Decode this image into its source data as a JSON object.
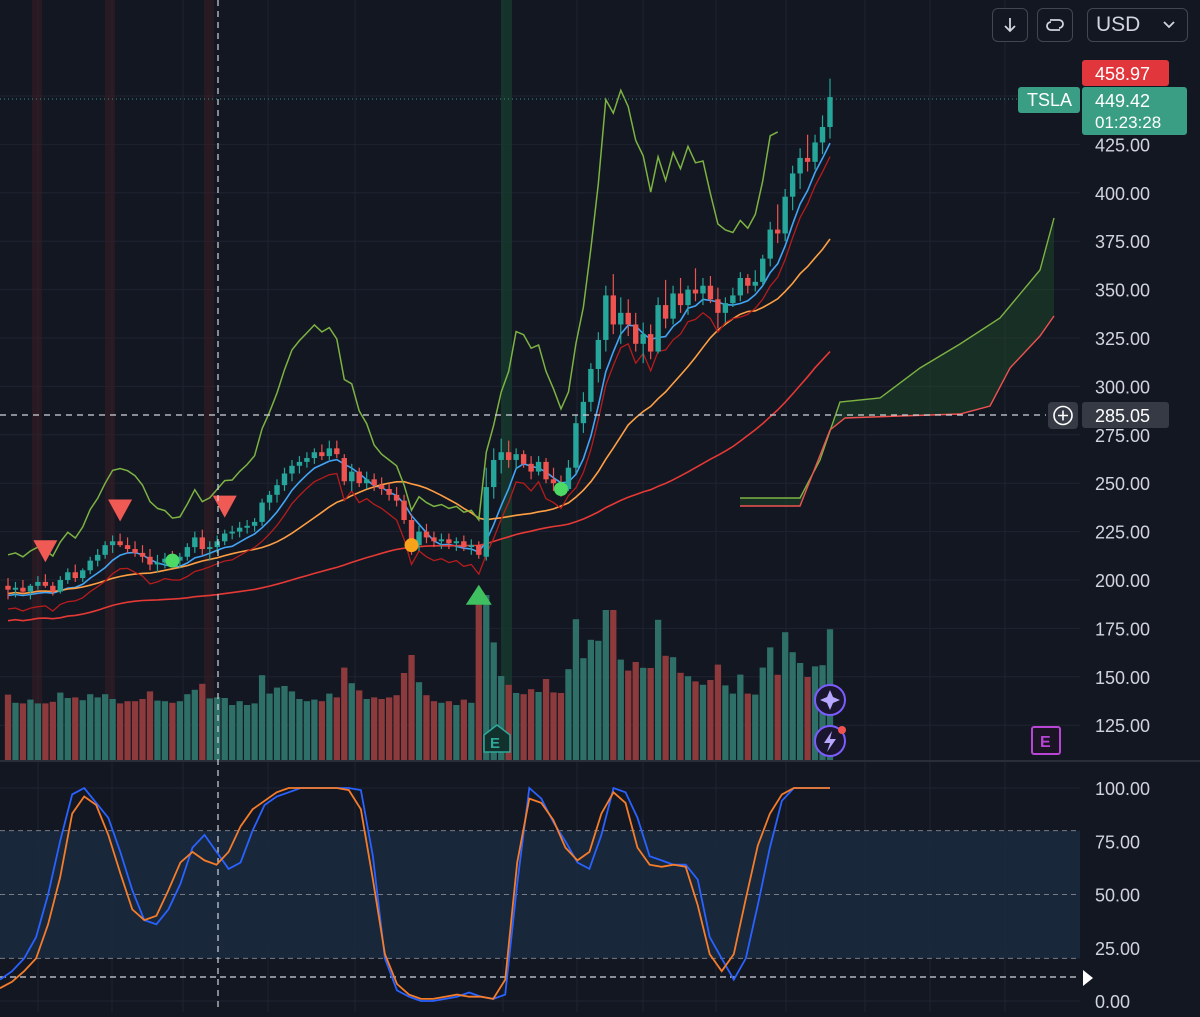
{
  "toolbar": {
    "currency_label": "USD",
    "icons": [
      "arrow-down-icon",
      "loop-icon",
      "chevron-down-icon"
    ]
  },
  "symbol": "TSLA",
  "price_tags": {
    "high": "458.97",
    "last": "449.42",
    "countdown": "01:23:28",
    "crosshair": "285.05"
  },
  "colors": {
    "background": "#131722",
    "up": "#26a69a",
    "down": "#ef5350",
    "volume_up": "#2e6f68",
    "volume_down": "#8c3a3c",
    "k_line": "#2962ff",
    "d_line": "#f57c2a",
    "upper_band": "#7cb342",
    "ma_blue": "#42a5f5",
    "ma_orange": "#ff9f43",
    "ma_red": "#e53935",
    "event_purple": "#b845d6"
  },
  "event_markers": {
    "earnings_letter": "E",
    "icons": [
      "sparkle-icon",
      "lightning-icon"
    ]
  },
  "chart_data": [
    {
      "type": "candlestick",
      "symbol": "TSLA",
      "currency": "USD",
      "y_ticks": [
        "125.00",
        "150.00",
        "175.00",
        "200.00",
        "225.00",
        "250.00",
        "275.00",
        "300.00",
        "325.00",
        "350.00",
        "375.00",
        "400.00",
        "425.00"
      ],
      "ylim": [
        112,
        475
      ],
      "scale": "linear",
      "grid": true,
      "candles": [
        {
          "o": 197,
          "h": 201,
          "l": 190,
          "c": 195
        },
        {
          "o": 195,
          "h": 199,
          "l": 191,
          "c": 196
        },
        {
          "o": 196,
          "h": 200,
          "l": 193,
          "c": 194
        },
        {
          "o": 194,
          "h": 198,
          "l": 190,
          "c": 197
        },
        {
          "o": 197,
          "h": 202,
          "l": 195,
          "c": 199
        },
        {
          "o": 199,
          "h": 203,
          "l": 196,
          "c": 197
        },
        {
          "o": 197,
          "h": 199,
          "l": 192,
          "c": 194
        },
        {
          "o": 194,
          "h": 202,
          "l": 193,
          "c": 200
        },
        {
          "o": 200,
          "h": 206,
          "l": 198,
          "c": 204
        },
        {
          "o": 204,
          "h": 208,
          "l": 199,
          "c": 201
        },
        {
          "o": 201,
          "h": 206,
          "l": 199,
          "c": 205
        },
        {
          "o": 205,
          "h": 212,
          "l": 203,
          "c": 210
        },
        {
          "o": 210,
          "h": 216,
          "l": 207,
          "c": 213
        },
        {
          "o": 213,
          "h": 220,
          "l": 211,
          "c": 218
        },
        {
          "o": 218,
          "h": 223,
          "l": 214,
          "c": 220
        },
        {
          "o": 220,
          "h": 224,
          "l": 217,
          "c": 218
        },
        {
          "o": 218,
          "h": 222,
          "l": 214,
          "c": 216
        },
        {
          "o": 216,
          "h": 220,
          "l": 212,
          "c": 214
        },
        {
          "o": 214,
          "h": 218,
          "l": 209,
          "c": 212
        },
        {
          "o": 212,
          "h": 216,
          "l": 205,
          "c": 208
        },
        {
          "o": 208,
          "h": 213,
          "l": 204,
          "c": 209
        },
        {
          "o": 209,
          "h": 214,
          "l": 206,
          "c": 211
        },
        {
          "o": 211,
          "h": 215,
          "l": 207,
          "c": 210
        },
        {
          "o": 210,
          "h": 214,
          "l": 206,
          "c": 212
        },
        {
          "o": 212,
          "h": 219,
          "l": 210,
          "c": 217
        },
        {
          "o": 217,
          "h": 225,
          "l": 214,
          "c": 222
        },
        {
          "o": 222,
          "h": 226,
          "l": 213,
          "c": 216
        },
        {
          "o": 216,
          "h": 220,
          "l": 210,
          "c": 217
        },
        {
          "o": 217,
          "h": 223,
          "l": 214,
          "c": 220
        },
        {
          "o": 220,
          "h": 226,
          "l": 218,
          "c": 224
        },
        {
          "o": 224,
          "h": 228,
          "l": 221,
          "c": 225
        },
        {
          "o": 225,
          "h": 230,
          "l": 222,
          "c": 227
        },
        {
          "o": 227,
          "h": 231,
          "l": 224,
          "c": 228
        },
        {
          "o": 228,
          "h": 232,
          "l": 225,
          "c": 230
        },
        {
          "o": 230,
          "h": 242,
          "l": 228,
          "c": 240
        },
        {
          "o": 240,
          "h": 246,
          "l": 236,
          "c": 244
        },
        {
          "o": 244,
          "h": 252,
          "l": 240,
          "c": 249
        },
        {
          "o": 249,
          "h": 258,
          "l": 246,
          "c": 255
        },
        {
          "o": 255,
          "h": 262,
          "l": 251,
          "c": 259
        },
        {
          "o": 259,
          "h": 264,
          "l": 255,
          "c": 261
        },
        {
          "o": 261,
          "h": 266,
          "l": 258,
          "c": 263
        },
        {
          "o": 263,
          "h": 268,
          "l": 260,
          "c": 266
        },
        {
          "o": 266,
          "h": 270,
          "l": 262,
          "c": 264
        },
        {
          "o": 264,
          "h": 272,
          "l": 262,
          "c": 268
        },
        {
          "o": 268,
          "h": 272,
          "l": 263,
          "c": 265
        },
        {
          "o": 263,
          "h": 265,
          "l": 249,
          "c": 251
        },
        {
          "o": 251,
          "h": 260,
          "l": 246,
          "c": 256
        },
        {
          "o": 256,
          "h": 258,
          "l": 248,
          "c": 250
        },
        {
          "o": 250,
          "h": 256,
          "l": 247,
          "c": 252
        },
        {
          "o": 252,
          "h": 255,
          "l": 246,
          "c": 249
        },
        {
          "o": 249,
          "h": 253,
          "l": 244,
          "c": 247
        },
        {
          "o": 247,
          "h": 250,
          "l": 241,
          "c": 244
        },
        {
          "o": 244,
          "h": 248,
          "l": 238,
          "c": 241
        },
        {
          "o": 241,
          "h": 244,
          "l": 229,
          "c": 231
        },
        {
          "o": 231,
          "h": 234,
          "l": 213,
          "c": 218
        },
        {
          "o": 218,
          "h": 228,
          "l": 215,
          "c": 225
        },
        {
          "o": 225,
          "h": 229,
          "l": 219,
          "c": 222
        },
        {
          "o": 222,
          "h": 225,
          "l": 217,
          "c": 220
        },
        {
          "o": 220,
          "h": 224,
          "l": 216,
          "c": 221
        },
        {
          "o": 221,
          "h": 224,
          "l": 216,
          "c": 219
        },
        {
          "o": 219,
          "h": 222,
          "l": 215,
          "c": 220
        },
        {
          "o": 220,
          "h": 223,
          "l": 215,
          "c": 217
        },
        {
          "o": 217,
          "h": 221,
          "l": 213,
          "c": 218
        },
        {
          "o": 218,
          "h": 220,
          "l": 211,
          "c": 213
        },
        {
          "o": 212,
          "h": 258,
          "l": 210,
          "c": 248
        },
        {
          "o": 248,
          "h": 268,
          "l": 242,
          "c": 262
        },
        {
          "o": 262,
          "h": 273,
          "l": 255,
          "c": 266
        },
        {
          "o": 266,
          "h": 272,
          "l": 258,
          "c": 262
        },
        {
          "o": 262,
          "h": 268,
          "l": 257,
          "c": 265
        },
        {
          "o": 265,
          "h": 267,
          "l": 258,
          "c": 260
        },
        {
          "o": 260,
          "h": 264,
          "l": 252,
          "c": 256
        },
        {
          "o": 256,
          "h": 264,
          "l": 254,
          "c": 261
        },
        {
          "o": 261,
          "h": 263,
          "l": 250,
          "c": 252
        },
        {
          "o": 252,
          "h": 258,
          "l": 246,
          "c": 250
        },
        {
          "o": 250,
          "h": 254,
          "l": 243,
          "c": 247
        },
        {
          "o": 247,
          "h": 262,
          "l": 246,
          "c": 258
        },
        {
          "o": 258,
          "h": 285,
          "l": 255,
          "c": 281
        },
        {
          "o": 281,
          "h": 297,
          "l": 276,
          "c": 292
        },
        {
          "o": 292,
          "h": 312,
          "l": 287,
          "c": 309
        },
        {
          "o": 309,
          "h": 328,
          "l": 302,
          "c": 324
        },
        {
          "o": 324,
          "h": 352,
          "l": 318,
          "c": 347
        },
        {
          "o": 347,
          "h": 358,
          "l": 327,
          "c": 332
        },
        {
          "o": 332,
          "h": 346,
          "l": 322,
          "c": 338
        },
        {
          "o": 338,
          "h": 345,
          "l": 326,
          "c": 332
        },
        {
          "o": 332,
          "h": 338,
          "l": 318,
          "c": 322
        },
        {
          "o": 322,
          "h": 333,
          "l": 312,
          "c": 327
        },
        {
          "o": 327,
          "h": 332,
          "l": 314,
          "c": 318
        },
        {
          "o": 318,
          "h": 346,
          "l": 317,
          "c": 342
        },
        {
          "o": 342,
          "h": 355,
          "l": 330,
          "c": 335
        },
        {
          "o": 335,
          "h": 352,
          "l": 332,
          "c": 348
        },
        {
          "o": 348,
          "h": 356,
          "l": 338,
          "c": 342
        },
        {
          "o": 342,
          "h": 352,
          "l": 337,
          "c": 350
        },
        {
          "o": 350,
          "h": 361,
          "l": 344,
          "c": 348
        },
        {
          "o": 348,
          "h": 356,
          "l": 342,
          "c": 352
        },
        {
          "o": 352,
          "h": 357,
          "l": 343,
          "c": 345
        },
        {
          "o": 345,
          "h": 351,
          "l": 330,
          "c": 338
        },
        {
          "o": 338,
          "h": 346,
          "l": 333,
          "c": 343
        },
        {
          "o": 343,
          "h": 351,
          "l": 341,
          "c": 347
        },
        {
          "o": 347,
          "h": 359,
          "l": 344,
          "c": 356
        },
        {
          "o": 356,
          "h": 358,
          "l": 348,
          "c": 352
        },
        {
          "o": 352,
          "h": 360,
          "l": 349,
          "c": 354
        },
        {
          "o": 354,
          "h": 368,
          "l": 352,
          "c": 366
        },
        {
          "o": 366,
          "h": 385,
          "l": 362,
          "c": 381
        },
        {
          "o": 381,
          "h": 394,
          "l": 374,
          "c": 379
        },
        {
          "o": 379,
          "h": 402,
          "l": 375,
          "c": 398
        },
        {
          "o": 398,
          "h": 414,
          "l": 391,
          "c": 410
        },
        {
          "o": 410,
          "h": 423,
          "l": 402,
          "c": 418
        },
        {
          "o": 418,
          "h": 430,
          "l": 411,
          "c": 416
        },
        {
          "o": 416,
          "h": 430,
          "l": 412,
          "c": 426
        },
        {
          "o": 426,
          "h": 440,
          "l": 420,
          "c": 434
        },
        {
          "o": 434,
          "h": 458.97,
          "l": 428,
          "c": 449.42
        }
      ],
      "volume_colors": "up/down",
      "markers": [
        {
          "type": "sell-triangle",
          "index": 5
        },
        {
          "type": "sell-triangle",
          "index": 15
        },
        {
          "type": "sell-triangle",
          "index": 29
        },
        {
          "type": "buy-triangle",
          "index": 63
        },
        {
          "type": "signal-dot",
          "index": 22,
          "color": "#4cd964"
        },
        {
          "type": "signal-dot",
          "index": 54,
          "color": "#f7a21b"
        },
        {
          "type": "signal-dot",
          "index": 74,
          "color": "#4cd964"
        }
      ]
    },
    {
      "type": "line",
      "title": "",
      "y_ticks": [
        "0.00",
        "25.00",
        "50.00",
        "75.00",
        "100.00"
      ],
      "ylim": [
        0,
        100
      ],
      "bands": [
        20,
        80
      ],
      "series": [
        {
          "color": "#2962ff",
          "values": [
            10,
            14,
            20,
            30,
            50,
            75,
            97,
            100,
            93,
            86,
            70,
            52,
            38,
            36,
            43,
            55,
            72,
            78,
            70,
            62,
            65,
            80,
            92,
            96,
            98,
            100,
            100,
            100,
            100,
            100,
            99,
            68,
            20,
            5,
            2,
            0,
            0,
            1,
            2,
            4,
            2,
            1,
            3,
            55,
            100,
            95,
            84,
            75,
            65,
            62,
            78,
            100,
            98,
            86,
            68,
            66,
            64,
            64,
            57,
            30,
            20,
            10,
            20,
            45,
            72,
            94,
            100,
            100,
            100,
            100
          ]
        },
        {
          "color": "#f57c2a",
          "values": [
            6,
            9,
            14,
            20,
            36,
            58,
            88,
            96,
            92,
            78,
            60,
            43,
            38,
            40,
            52,
            65,
            70,
            66,
            64,
            70,
            82,
            90,
            94,
            98,
            100,
            100,
            100,
            100,
            100,
            99,
            90,
            57,
            22,
            8,
            3,
            1,
            1,
            2,
            3,
            2,
            2,
            1,
            10,
            65,
            95,
            93,
            85,
            72,
            66,
            70,
            88,
            98,
            93,
            72,
            64,
            63,
            64,
            63,
            45,
            22,
            14,
            22,
            48,
            73,
            88,
            97,
            100,
            100,
            100,
            100
          ]
        }
      ]
    }
  ]
}
